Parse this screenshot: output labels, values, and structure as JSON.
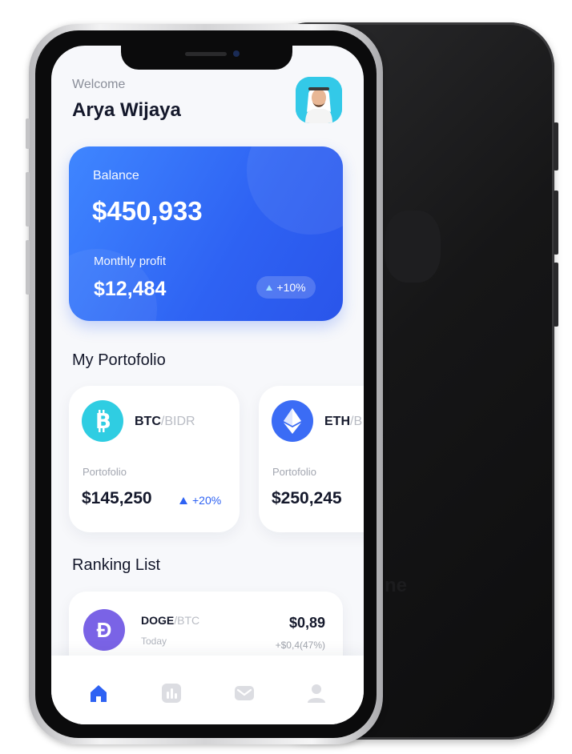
{
  "header": {
    "welcome": "Welcome",
    "user_name": "Arya Wijaya"
  },
  "balance_card": {
    "balance_label": "Balance",
    "balance_value": "$450,933",
    "profit_label": "Monthly profit",
    "profit_value": "$12,484",
    "profit_change": "+10%"
  },
  "portfolio": {
    "title": "My Portofolio",
    "cards": [
      {
        "base": "BTC",
        "quote": "/BIDR",
        "label": "Portofolio",
        "value": "$145,250",
        "change": "+20%",
        "icon_color": "#2fcde2",
        "icon": "bitcoin-icon"
      },
      {
        "base": "ETH",
        "quote": "/B",
        "label": "Portofolio",
        "value": "$250,245",
        "icon_color": "#3b6cf5",
        "icon": "ethereum-icon"
      }
    ]
  },
  "ranking": {
    "title": "Ranking List",
    "items": [
      {
        "base": "DOGE",
        "quote": "/BTC",
        "sub": "Today",
        "price": "$0,89",
        "change": "+$0,4(47%)",
        "icon_color": "#7a63e6",
        "icon": "dogecoin-icon"
      }
    ]
  },
  "nav": {
    "items": [
      "home-icon",
      "chart-icon",
      "mail-icon",
      "profile-icon"
    ],
    "active_color": "#2e62f3",
    "inactive_color": "#dcdde2"
  },
  "colors": {
    "accent": "#2e62f3",
    "card_gradient_start": "#3f86ff"
  }
}
